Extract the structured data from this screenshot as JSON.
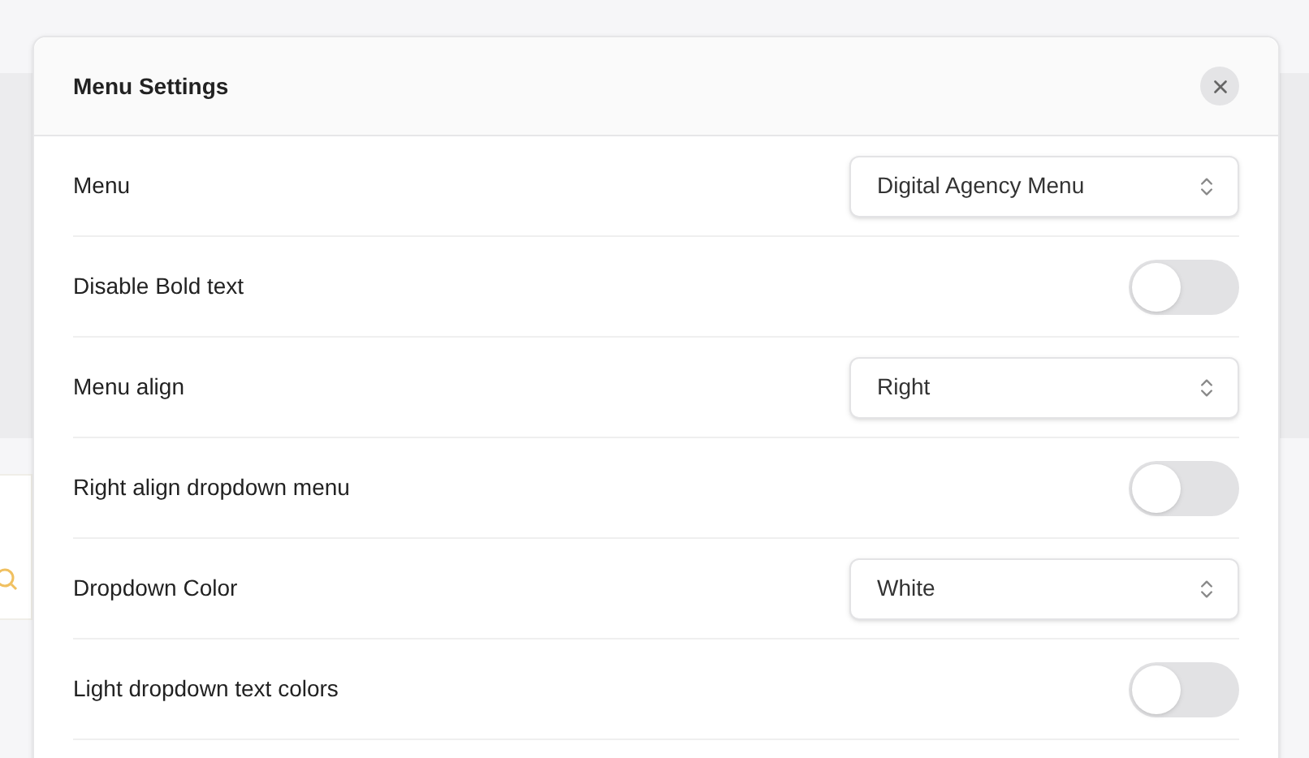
{
  "dialog": {
    "title": "Menu Settings"
  },
  "settings": [
    {
      "kind": "select",
      "label": "Menu",
      "value": "Digital Agency Menu"
    },
    {
      "kind": "toggle",
      "label": "Disable Bold text",
      "on": false
    },
    {
      "kind": "select",
      "label": "Menu align",
      "value": "Right"
    },
    {
      "kind": "toggle",
      "label": "Right align dropdown menu",
      "on": false
    },
    {
      "kind": "select",
      "label": "Dropdown Color",
      "value": "White"
    },
    {
      "kind": "toggle",
      "label": "Light dropdown text colors",
      "on": false
    }
  ]
}
